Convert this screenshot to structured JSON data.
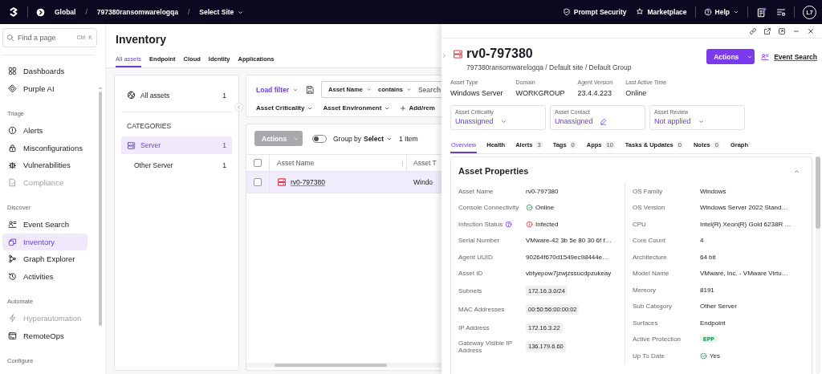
{
  "topbar": {
    "breadcrumb": [
      {
        "kind": "scope",
        "label": "Global"
      },
      {
        "kind": "separator",
        "label": "/"
      },
      {
        "kind": "account",
        "label": "797380ransomwarelogqa"
      },
      {
        "kind": "separator",
        "label": "/"
      },
      {
        "kind": "dropdown",
        "label": "Select Site"
      }
    ],
    "links": [
      {
        "label": "Prompt Security"
      },
      {
        "label": "Marketplace"
      }
    ],
    "help": "Help",
    "avatar": "L7"
  },
  "sidebar": {
    "search": {
      "placeholder": "Find a page",
      "shortcut": "Ctrl  K"
    },
    "sections": [
      {
        "items": [
          {
            "label": "Dashboards",
            "selected": false,
            "disabled": false
          },
          {
            "label": "Purple AI",
            "selected": false,
            "disabled": false
          }
        ]
      },
      {
        "title": "Triage",
        "items": [
          {
            "label": "Alerts",
            "selected": false,
            "disabled": false
          },
          {
            "label": "Misconfigurations",
            "selected": false,
            "disabled": false
          },
          {
            "label": "Vulnerabilities",
            "selected": false,
            "disabled": false
          },
          {
            "label": "Compliance",
            "selected": false,
            "disabled": true
          }
        ]
      },
      {
        "title": "Discover",
        "items": [
          {
            "label": "Event Search",
            "selected": false,
            "disabled": false
          },
          {
            "label": "Inventory",
            "selected": true,
            "disabled": false
          },
          {
            "label": "Graph Explorer",
            "selected": false,
            "disabled": false
          },
          {
            "label": "Activities",
            "selected": false,
            "disabled": false
          }
        ]
      },
      {
        "title": "Automate",
        "items": [
          {
            "label": "Hyperautomation",
            "selected": false,
            "disabled": true
          },
          {
            "label": "RemoteOps",
            "selected": false,
            "disabled": false
          }
        ]
      },
      {
        "title": "Configure"
      }
    ]
  },
  "inventory": {
    "title": "Inventory",
    "tabs": [
      {
        "label": "All assets",
        "selected": true
      },
      {
        "label": "Endpoint",
        "selected": false
      },
      {
        "label": "Cloud",
        "selected": false
      },
      {
        "label": "Identity",
        "selected": false
      },
      {
        "label": "Applications",
        "selected": false
      }
    ],
    "categories": {
      "all": {
        "label": "All assets",
        "count": "1"
      },
      "heading": "CATEGORIES",
      "items": [
        {
          "label": "Server",
          "count": "1",
          "selected": true,
          "children": [
            {
              "label": "Other Server",
              "count": "1",
              "selected": false
            }
          ]
        }
      ]
    },
    "filters": {
      "load_filter": "Load filter",
      "field": "Asset Name",
      "operator": "contains",
      "search_placeholder": "Search",
      "chips": [
        "Asset Criticality",
        "Asset Environment"
      ],
      "add": "Add/rem"
    },
    "toolbar": {
      "actions": {
        "label": "Actions",
        "disabled": true
      },
      "group_by": {
        "label": "Group by",
        "value": "Select",
        "on": false
      },
      "count": "1 Item"
    },
    "table": {
      "select_all_checked": false,
      "columns": [
        "Asset Name",
        "Asset T"
      ],
      "rows": [
        {
          "checked": false,
          "selected": true,
          "cells": [
            "rv0-797380",
            "Windo"
          ]
        }
      ]
    }
  },
  "asset_panel": {
    "title": "rv0-797380",
    "path": "797380ransomwarelogqa / Default site / Default Group",
    "actions": "Actions",
    "event_search": "Event Search",
    "summary": [
      {
        "label": "Asset Type",
        "value": "Windows Server"
      },
      {
        "label": "Domain",
        "value": "WORKGROUP"
      },
      {
        "label": "Agent Version",
        "value": "23.4.4.223"
      },
      {
        "label": "Last Active Time",
        "value": "Online"
      }
    ],
    "fields": [
      {
        "label": "Asset Criticality",
        "value": "Unassigned",
        "kind": "dropdown"
      },
      {
        "label": "Asset Contact",
        "value": "Unassigned",
        "kind": "edit"
      },
      {
        "label": "Asset Review",
        "value": "Not applied",
        "kind": "dropdown"
      }
    ],
    "tabs": [
      {
        "label": "Overview",
        "selected": true
      },
      {
        "label": "Health",
        "selected": false
      },
      {
        "label": "Alerts",
        "count": "3",
        "selected": false
      },
      {
        "label": "Tags",
        "count": "0",
        "selected": false
      },
      {
        "label": "Apps",
        "count": "10",
        "selected": false
      },
      {
        "label": "Tasks & Updates",
        "count": "0",
        "selected": false
      },
      {
        "label": "Notes",
        "count": "0",
        "selected": false
      },
      {
        "label": "Graph",
        "selected": false
      }
    ],
    "properties": {
      "title": "Asset Properties",
      "expanded": true,
      "columns": [
        [
          {
            "label": "Asset Name",
            "value": "rv0-797380",
            "kind": "text",
            "help": false
          },
          {
            "label": "Console Connectivity",
            "value": "Online",
            "kind": "ok",
            "help": false
          },
          {
            "label": "Infection Status",
            "value": "Infected",
            "kind": "bad",
            "help": true
          },
          {
            "label": "Serial Number",
            "value": "VMware-42 3b 5e 80 30 6f f…",
            "kind": "text",
            "help": false
          },
          {
            "label": "Agent UUID",
            "value": "90264f670d1549ec98444e…",
            "kind": "text",
            "help": false
          },
          {
            "label": "Asset ID",
            "value": "vbtyepow7jzwjzssucdpzukeay",
            "kind": "text",
            "help": false
          },
          {
            "label": "Subnets",
            "value": "172.16.3.0/24",
            "kind": "chip",
            "help": false
          },
          {
            "label": "MAC Addresses",
            "value": "00:50:56:00:00:02",
            "kind": "chip",
            "help": false
          },
          {
            "label": "IP Address",
            "value": "172.16.3.22",
            "kind": "chip",
            "help": false
          },
          {
            "label": "Gateway Visible IP Address",
            "value": "136.179.6.60",
            "kind": "chip",
            "help": false
          }
        ],
        [
          {
            "label": "OS Family",
            "value": "Windows",
            "kind": "text",
            "help": false
          },
          {
            "label": "OS Version",
            "value": "Windows Server 2022 Stand…",
            "kind": "text",
            "help": false
          },
          {
            "label": "CPU",
            "value": "Intel(R) Xeon(R) Gold 6238R …",
            "kind": "text",
            "help": false
          },
          {
            "label": "Core Count",
            "value": "4",
            "kind": "text",
            "help": false
          },
          {
            "label": "Architecture",
            "value": "64 bit",
            "kind": "text",
            "help": false
          },
          {
            "label": "Model Name",
            "value": "VMware, Inc. - VMware Virtu…",
            "kind": "text",
            "help": false
          },
          {
            "label": "Memory",
            "value": "8191",
            "kind": "text",
            "help": false
          },
          {
            "label": "Sub Category",
            "value": "Other Server",
            "kind": "text",
            "help": false
          },
          {
            "label": "Surfaces",
            "value": "Endpoint",
            "kind": "text",
            "help": false
          },
          {
            "label": "Active Protection",
            "value": "EPP",
            "kind": "tag",
            "help": false
          },
          {
            "label": "Up To Date",
            "value": "Yes",
            "kind": "ok",
            "help": false
          }
        ]
      ]
    }
  }
}
